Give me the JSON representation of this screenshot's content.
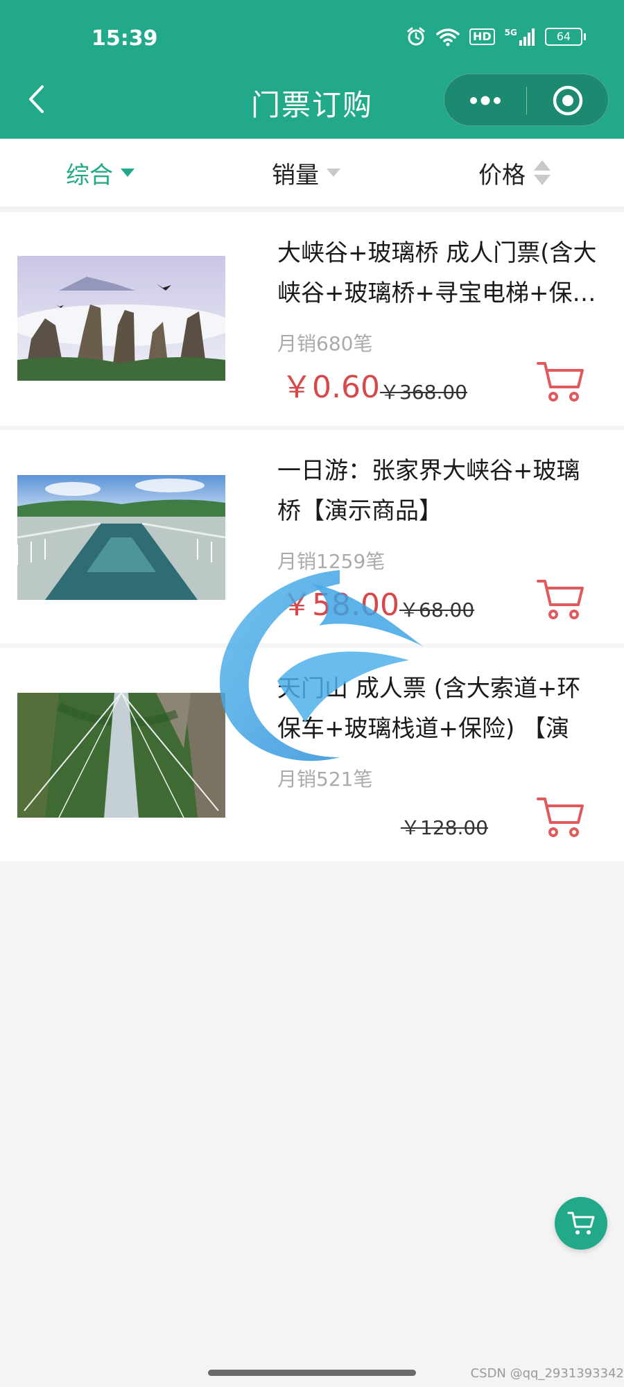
{
  "status_bar": {
    "time": "15:39",
    "network_badge": "HD",
    "network_type": "5G",
    "battery": "64"
  },
  "header": {
    "title": "门票订购",
    "back_icon": "chevron-left-icon",
    "more_icon": "more-dots-icon",
    "close_icon": "target-circle-icon"
  },
  "sort_bar": {
    "items": [
      {
        "label": "综合",
        "state": "active"
      },
      {
        "label": "销量",
        "state": "inactive"
      },
      {
        "label": "价格",
        "state": "inactive"
      }
    ]
  },
  "products": [
    {
      "title": "大峡谷+玻璃桥 成人门票(含大峡谷+玻璃桥+寻宝电梯+保…",
      "sales": "月销680笔",
      "price": "￥0.60",
      "original_price": "￥368.00",
      "image": "karst-mountains-image"
    },
    {
      "title": "一日游：张家界大峡谷+玻璃桥【演示商品】",
      "sales": "月销1259笔",
      "price": "￥58.00",
      "original_price": "￥68.00",
      "image": "glass-bridge-image"
    },
    {
      "title": "天门山 成人票 (含大索道+环保车+玻璃栈道+保险) 【演示…",
      "sales": "月销521笔",
      "price": "",
      "original_price": "￥128.00",
      "image": "canyon-bridge-image"
    }
  ],
  "floating_cart": {
    "icon": "cart-icon"
  },
  "watermark": "CSDN @qq_2931393342",
  "colors": {
    "primary": "#22a989",
    "price_red": "#d8474a",
    "cart_red": "#e05a5d",
    "background": "#f4f4f4"
  }
}
